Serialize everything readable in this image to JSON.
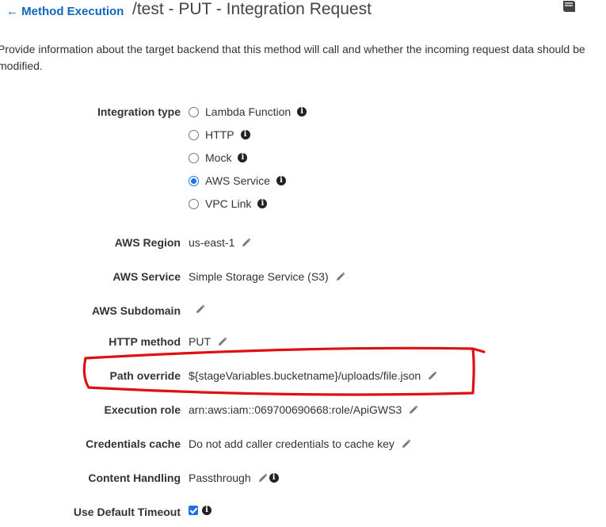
{
  "header": {
    "back_label": "Method Execution",
    "title": "/test - PUT - Integration Request",
    "back_arrow": "←"
  },
  "description": "Provide information about the target backend that this method will call and whether the incoming request data should be modified.",
  "integration_type": {
    "label": "Integration type",
    "options": [
      "Lambda Function",
      "HTTP",
      "Mock",
      "AWS Service",
      "VPC Link"
    ],
    "selected": "AWS Service"
  },
  "fields": {
    "aws_region": {
      "label": "AWS Region",
      "value": "us-east-1"
    },
    "aws_service": {
      "label": "AWS Service",
      "value": "Simple Storage Service (S3)"
    },
    "aws_subdomain": {
      "label": "AWS Subdomain",
      "value": ""
    },
    "http_method": {
      "label": "HTTP method",
      "value": "PUT"
    },
    "path_override": {
      "label": "Path override",
      "value": "${stageVariables.bucketname}/uploads/file.json"
    },
    "execution_role": {
      "label": "Execution role",
      "value": "arn:aws:iam::069700690668:role/ApiGWS3"
    },
    "credentials_cache": {
      "label": "Credentials cache",
      "value": "Do not add caller credentials to cache key"
    },
    "content_handling": {
      "label": "Content Handling",
      "value": "Passthrough"
    },
    "use_default_timeout": {
      "label": "Use Default Timeout",
      "checked": true
    }
  },
  "icons": {
    "info": "i",
    "annotation_color": "#dd1111",
    "accent_color": "#1a73e8",
    "link_color": "#1166bb"
  }
}
